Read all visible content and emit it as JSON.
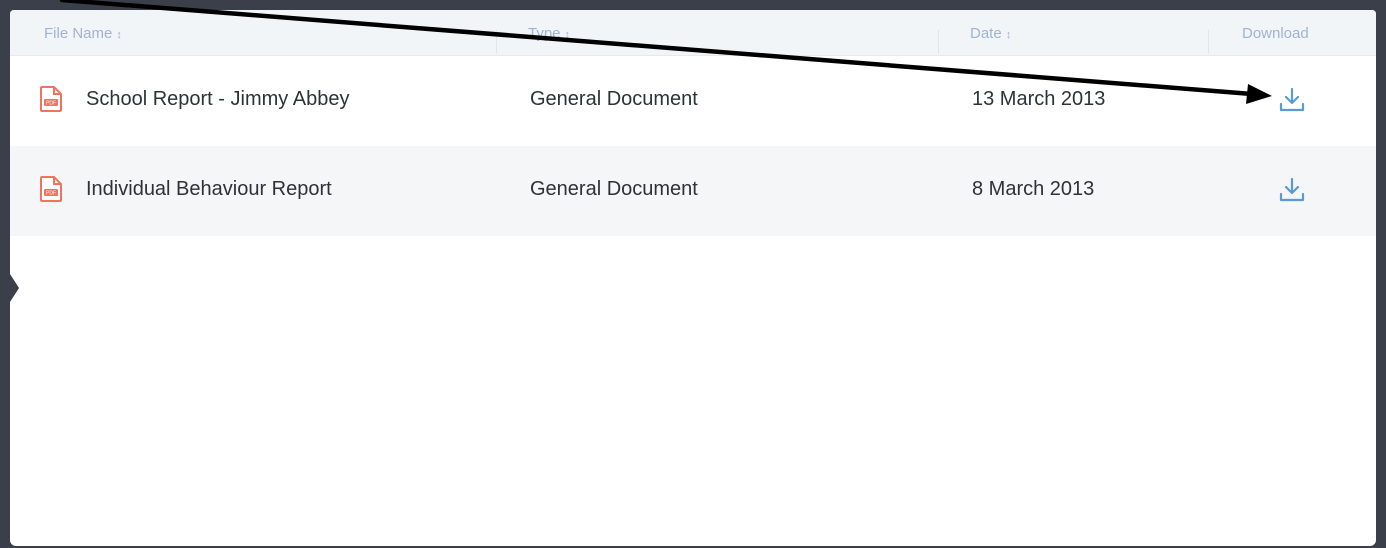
{
  "table": {
    "headers": {
      "file_name": "File Name",
      "type": "Type",
      "date": "Date",
      "download": "Download"
    },
    "rows": [
      {
        "file_name": "School Report - Jimmy Abbey",
        "type": "General Document",
        "date": "13 March 2013",
        "icon": "pdf-file-icon",
        "action_icon": "download-icon"
      },
      {
        "file_name": "Individual Behaviour Report",
        "type": "General Document",
        "date": "8 March 2013",
        "icon": "pdf-file-icon",
        "action_icon": "download-icon"
      }
    ]
  },
  "icons": {
    "sort": "sort-icon",
    "pdf_label": "PDF"
  },
  "colors": {
    "header_text": "#9fb3d3",
    "pdf_icon": "#f0735f",
    "download_icon": "#5b9bd5",
    "row_alt_bg": "#f4f6f8",
    "frame": "#3a3f4a",
    "annotation_arrow": "#000000"
  }
}
